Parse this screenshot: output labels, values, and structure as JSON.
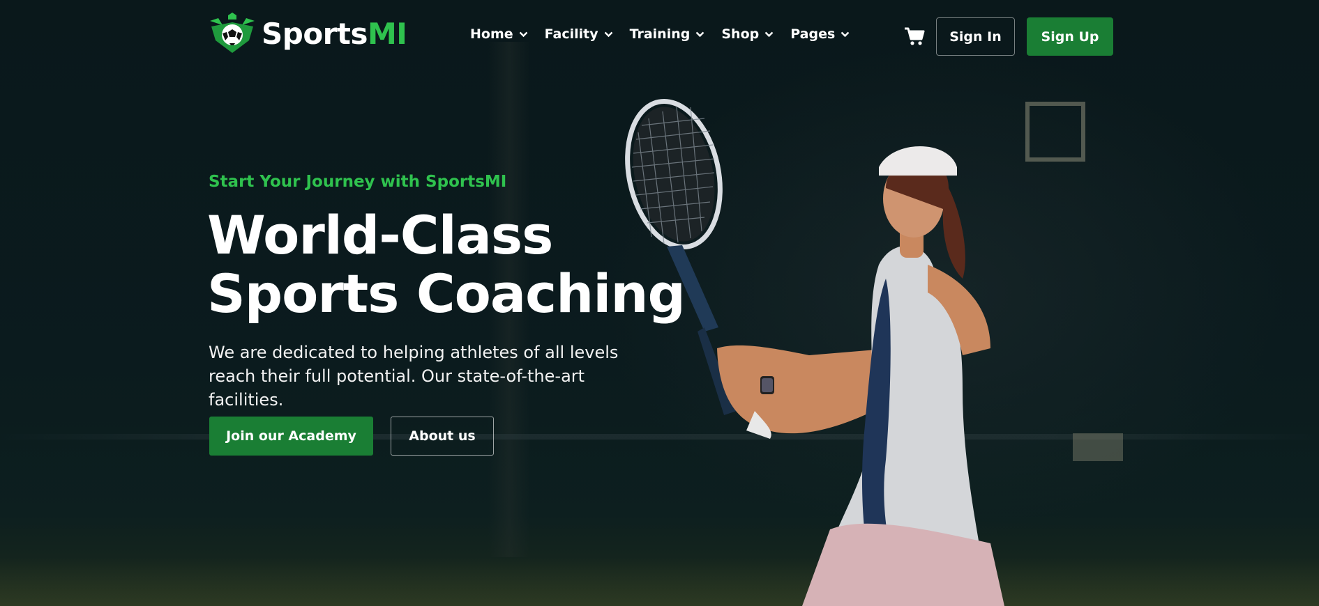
{
  "brand": {
    "name_white": "Sports",
    "name_green": "MI",
    "accent_color": "#2fc24e",
    "button_color": "#1a7e34"
  },
  "nav": {
    "items": [
      {
        "label": "Home",
        "icon": "chevron-down-icon"
      },
      {
        "label": "Facility",
        "icon": "chevron-down-icon"
      },
      {
        "label": "Training",
        "icon": "chevron-down-icon"
      },
      {
        "label": "Shop",
        "icon": "chevron-down-icon"
      },
      {
        "label": "Pages",
        "icon": "chevron-down-icon"
      }
    ],
    "cart_icon": "cart-icon",
    "sign_in": "Sign In",
    "sign_up": "Sign Up"
  },
  "hero": {
    "eyebrow": "Start Your Journey with SportsMI",
    "headline_line1": "World-Class",
    "headline_line2": "Sports Coaching",
    "lede": "We are dedicated to helping athletes of all levels reach their full potential. Our state-of-the-art facilities.",
    "primary_cta": "Join our Academy",
    "secondary_cta": "About us",
    "image": "tennis-player-illustration"
  }
}
